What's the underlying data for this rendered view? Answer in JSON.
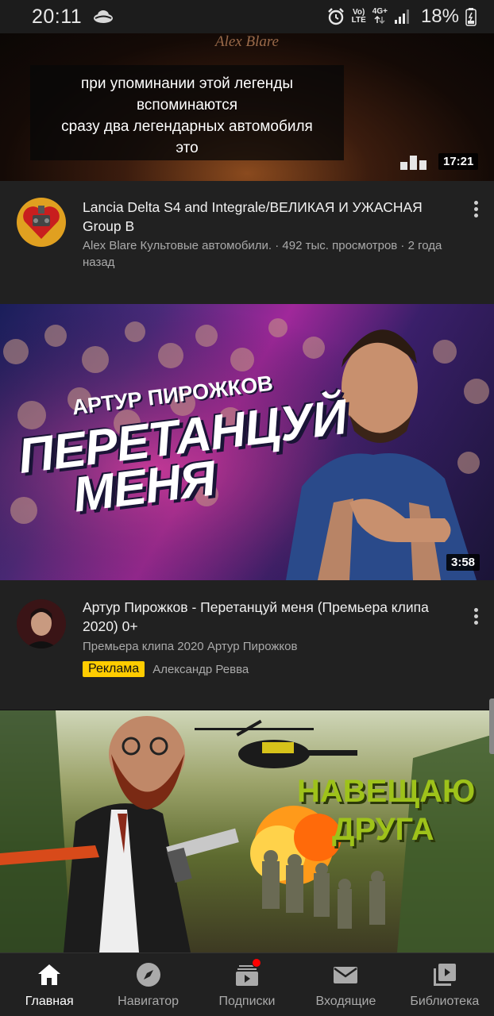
{
  "status_bar": {
    "time": "20:11",
    "network_top": "Vo)",
    "network_bottom": "LTE",
    "signal_top": "4G+",
    "battery": "18%"
  },
  "videos": [
    {
      "channel_brand": "Alex Blare",
      "captions": [
        "при упоминании этой легенды",
        "вспоминаются",
        "сразу два легендарных автомобиля",
        "это"
      ],
      "duration": "17:21",
      "title": "Lancia Delta S4 and Integrale/ВЕЛИКАЯ И УЖАСНАЯ Group B",
      "meta": "Alex Blare Культовые автомобили. · 492 тыс. просмотров · 2 года назад"
    },
    {
      "thumb_top_text": "АРТУР ПИРОЖКОВ",
      "thumb_line1": "ПЕРЕТАНЦУЙ",
      "thumb_line2": "МЕНЯ",
      "duration": "3:58",
      "title": "Артур Пирожков - Перетанцуй меня (Премьера клипа 2020) 0+",
      "meta": "Премьера клипа 2020 Артур Пирожков",
      "ad_badge": "Реклама",
      "ad_author": "Александр Ревва"
    },
    {
      "thumb_line1": "НАВЕЩАЮ",
      "thumb_line2": "ДРУГА"
    }
  ],
  "nav": [
    {
      "label": "Главная",
      "icon": "home-icon",
      "active": true
    },
    {
      "label": "Навигатор",
      "icon": "compass-icon",
      "active": false
    },
    {
      "label": "Подписки",
      "icon": "subscriptions-icon",
      "active": false
    },
    {
      "label": "Входящие",
      "icon": "inbox-icon",
      "active": false
    },
    {
      "label": "Библиотека",
      "icon": "library-icon",
      "active": false
    }
  ],
  "colors": {
    "background": "#212121",
    "ad_badge": "#ffcc00",
    "notification": "#ff0000"
  }
}
